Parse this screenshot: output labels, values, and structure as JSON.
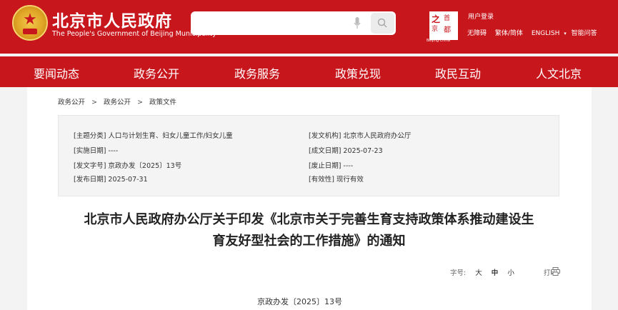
{
  "header": {
    "title": "北京市人民政府",
    "subtitle": "The People's Government of Beijing Municipality",
    "search_placeholder": "",
    "capital_logo": {
      "c1": "之",
      "c2": "首",
      "c3": "京",
      "c4": "都",
      "caption": "Beijing·China"
    },
    "user_login": "用户登录",
    "utils": [
      "无障碍",
      "繁体/简体",
      "ENGLISH",
      "▾",
      "智能问答"
    ]
  },
  "nav": [
    "要闻动态",
    "政务公开",
    "政务服务",
    "政策兑现",
    "政民互动",
    "人文北京"
  ],
  "breadcrumb": [
    "政务公开",
    ">",
    "政务公开",
    ">",
    "政策文件"
  ],
  "info": {
    "topic": "[主题分类] 人口与计划生育、妇女儿童工作/妇女儿童",
    "issuer": "[发文机构] 北京市人民政府办公厅",
    "effective": "[实施日期] ----",
    "written": "[成文日期] 2025-07-23",
    "doc_number": "[发文字号] 京政办发〔2025〕13号",
    "expiry": "[废止日期] ----",
    "published": "[发布日期] 2025-07-31",
    "validity": "[有效性] 现行有效"
  },
  "doc": {
    "title_line1": "北京市人民政府办公厅关于印发《北京市关于完善生育支持政策体系推动建设生",
    "title_line2": "育友好型社会的工作措施》的通知",
    "font_size_label": "字号:",
    "size_large": "大",
    "size_medium": "中",
    "size_small": "小",
    "print": "打印",
    "number": "京政办发〔2025〕13号"
  },
  "colors": {
    "brand_red": "#c8161d",
    "page_bg": "#f3f3f3",
    "info_bg": "#f4f4f4"
  }
}
